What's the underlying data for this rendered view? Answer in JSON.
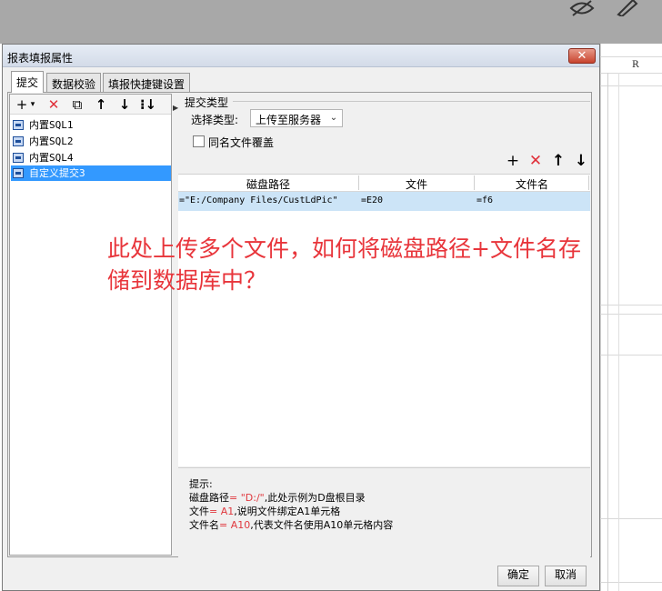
{
  "dialog": {
    "title": "报表填报属性",
    "close_label": "✕"
  },
  "tabs": [
    {
      "label": "提交",
      "active": true
    },
    {
      "label": "数据校验",
      "active": false
    },
    {
      "label": "填报快捷键设置",
      "active": false
    }
  ],
  "left_toolbar": {
    "add": "+",
    "add_caret": "▾",
    "delete": "✕",
    "copy": "⧉",
    "up": "↑",
    "down": "↓",
    "more": "⁝↓"
  },
  "submit_list": [
    {
      "label": "内置SQL1",
      "selected": false
    },
    {
      "label": "内置SQL2",
      "selected": false
    },
    {
      "label": "内置SQL4",
      "selected": false
    },
    {
      "label": "自定义提交3",
      "selected": true
    }
  ],
  "submit_type": {
    "group_title": "提交类型",
    "select_label": "选择类型:",
    "select_value": "上传至服务器",
    "overwrite_label": "同名文件覆盖",
    "overwrite_checked": false
  },
  "table_toolbar": {
    "add": "+",
    "delete": "✕",
    "up": "↑",
    "down": "↓"
  },
  "table": {
    "headers": [
      "磁盘路径",
      "文件",
      "文件名"
    ],
    "rows": [
      {
        "path": "=\"E:/Company Files/CustLdPic\"",
        "file": "=E20",
        "name": "=f6"
      }
    ]
  },
  "annotation": {
    "line1": "此处上传多个文件，如何将磁盘路径+文件名存",
    "line2": "储到数据库中？"
  },
  "tips": {
    "title": "提示:",
    "line1_a": "磁盘路径",
    "line1_b": "= \"D:/\"",
    "line1_c": ",此处示例为D盘根目录",
    "line2_a": "文件",
    "line2_b": "= A1",
    "line2_c": ",说明文件绑定A1单元格",
    "line3_a": "文件名",
    "line3_b": "= A10",
    "line3_c": ",代表文件名使用A10单元格内容"
  },
  "buttons": {
    "ok": "确定",
    "cancel": "取消"
  },
  "background": {
    "column_header": "R"
  },
  "colors": {
    "selection": "#3399ff",
    "row_highlight": "#cce4f7",
    "annotation": "#e8353b",
    "close_button": "#c8442e"
  }
}
